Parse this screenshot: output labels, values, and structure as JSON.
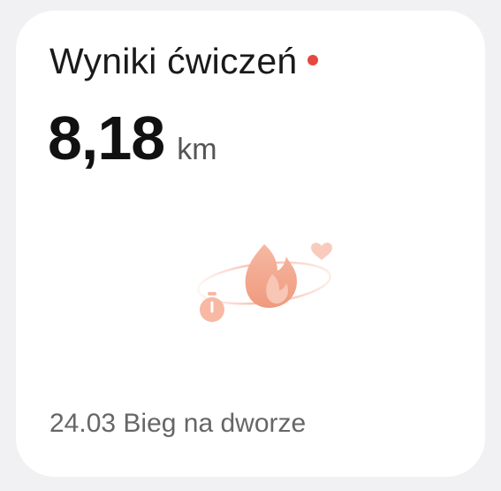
{
  "card": {
    "title": "Wyniki ćwiczeń",
    "value": "8,18",
    "unit": "km",
    "footer": "24.03 Bieg na dworze",
    "illustration_icon": "fire-exercise-icon"
  },
  "colors": {
    "status_dot": "#e5483f",
    "accent": "#f08a6c"
  }
}
